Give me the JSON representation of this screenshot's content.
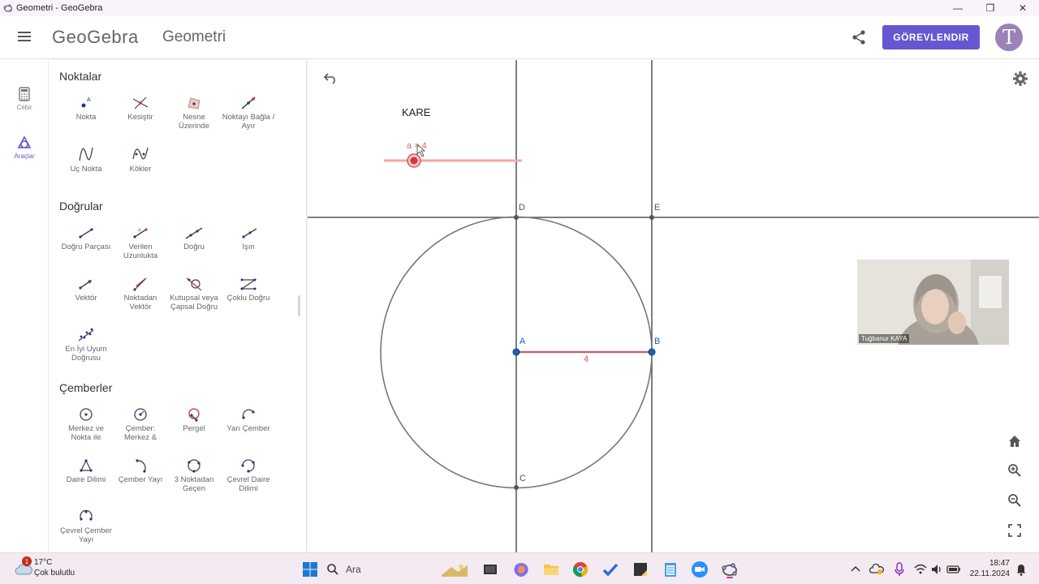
{
  "window": {
    "title": "Geometri - GeoGebra",
    "controls": [
      "—",
      "❐",
      "✕"
    ]
  },
  "header": {
    "brand": "GeoGebra",
    "app_name": "Geometri",
    "assign_button": "GÖREVLENDIR",
    "avatar_letter": "T"
  },
  "rail": {
    "items": [
      {
        "label": "Cebir",
        "icon": "calculator-icon"
      },
      {
        "label": "Araçlar",
        "icon": "tools-icon"
      }
    ]
  },
  "tools": {
    "sections": [
      {
        "title": "Noktalar",
        "items": [
          "Nokta",
          "Kesiştir",
          "Nesne Üzerinde",
          "Noktayı Bağla / Ayır",
          "Uç Nokta",
          "Kökler"
        ]
      },
      {
        "title": "Doğrular",
        "items": [
          "Doğru Parçası",
          "Verilen Uzunlukta",
          "Doğru",
          "Işın",
          "Vektör",
          "Noktadan Vektör",
          "Kutupsal veya Çapsal Doğru",
          "Çoklu Doğru",
          "En İyi Uyum Doğrusu"
        ]
      },
      {
        "title": "Çemberler",
        "items": [
          "Merkez ve Nokta ile",
          "Çember: Merkez &",
          "Pergel",
          "Yarı Çember",
          "Daire Dilimi",
          "Çember Yayı",
          "3 Noktadan Geçen",
          "Çevrel Daire Dilimi",
          "Çevrel Çember Yayı"
        ]
      }
    ]
  },
  "canvas": {
    "text_kare": "KARE",
    "slider_label": "a = 4",
    "segment_label": "4",
    "points": {
      "A": "A",
      "B": "B",
      "C": "C",
      "D": "D",
      "E": "E"
    },
    "colors": {
      "axis": "#555555",
      "circle": "#777777",
      "segment": "#d9555f",
      "point": "#1565c0",
      "slider": "#f4a6ab"
    }
  },
  "webcam": {
    "name": "Tuğbanur KAYA"
  },
  "taskbar": {
    "weather_temp": "17°C",
    "weather_desc": "Çok bulutlu",
    "weather_badge": "1",
    "search_label": "Ara",
    "time": "18:47",
    "date": "22.11.2024"
  }
}
